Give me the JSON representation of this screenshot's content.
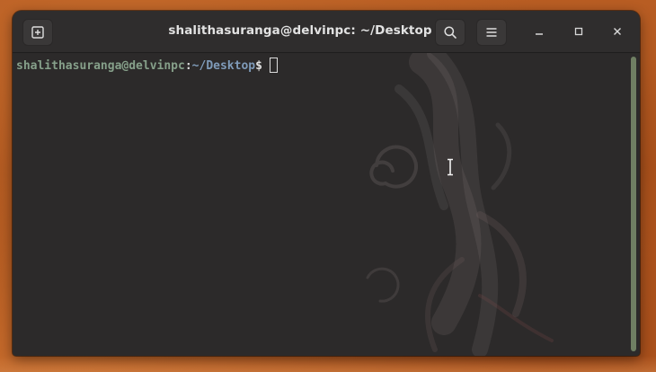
{
  "window": {
    "title": "shalithasuranga@delvinpc: ~/Desktop"
  },
  "toolbar": {
    "new_tab_icon": "new-tab-icon",
    "search_icon": "search-icon",
    "menu_icon": "hamburger-menu-icon",
    "minimize_icon": "minimize-icon",
    "maximize_icon": "maximize-icon",
    "close_icon": "close-icon"
  },
  "terminal": {
    "prompt_user": "shalithasuranga@delvinpc",
    "prompt_separator": ":",
    "prompt_path": "~/Desktop",
    "prompt_symbol": "$",
    "input_text": ""
  },
  "colors": {
    "prompt_user": "#86a08a",
    "prompt_path": "#7f9bb9",
    "terminal_bg": "#2c2a2a",
    "titlebar_bg": "#2f2d2d",
    "desktop_accent": "#b85d23",
    "scrollbar": "#6f7f63"
  }
}
